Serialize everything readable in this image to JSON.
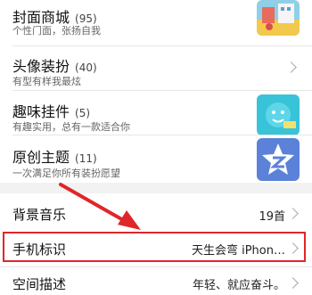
{
  "items": [
    {
      "title": "封面商城",
      "count": "(95)",
      "desc": "个性门面，张扬自我"
    },
    {
      "title": "头像装扮",
      "count": "(40)",
      "desc": "有型有样我最炫"
    },
    {
      "title": "趣味挂件",
      "count": "(5)",
      "desc": "有趣实用，总有一款适合你"
    },
    {
      "title": "原创主题",
      "count": "(11)",
      "desc": "一次满足你所有装扮愿望"
    }
  ],
  "settings": [
    {
      "label": "背景音乐",
      "value": "19首"
    },
    {
      "label": "手机标识",
      "value": "天生会弯 iPhon…"
    },
    {
      "label": "空间描述",
      "value": "年轻、就应奋斗。"
    }
  ],
  "colors": {
    "highlight": "#e0262a",
    "arrow": "#e0262a"
  },
  "icons": [
    "cover-thumbnail",
    "chevron-right-icon",
    "pendant-thumbnail",
    "theme-star-icon",
    "arrow-annotation"
  ]
}
